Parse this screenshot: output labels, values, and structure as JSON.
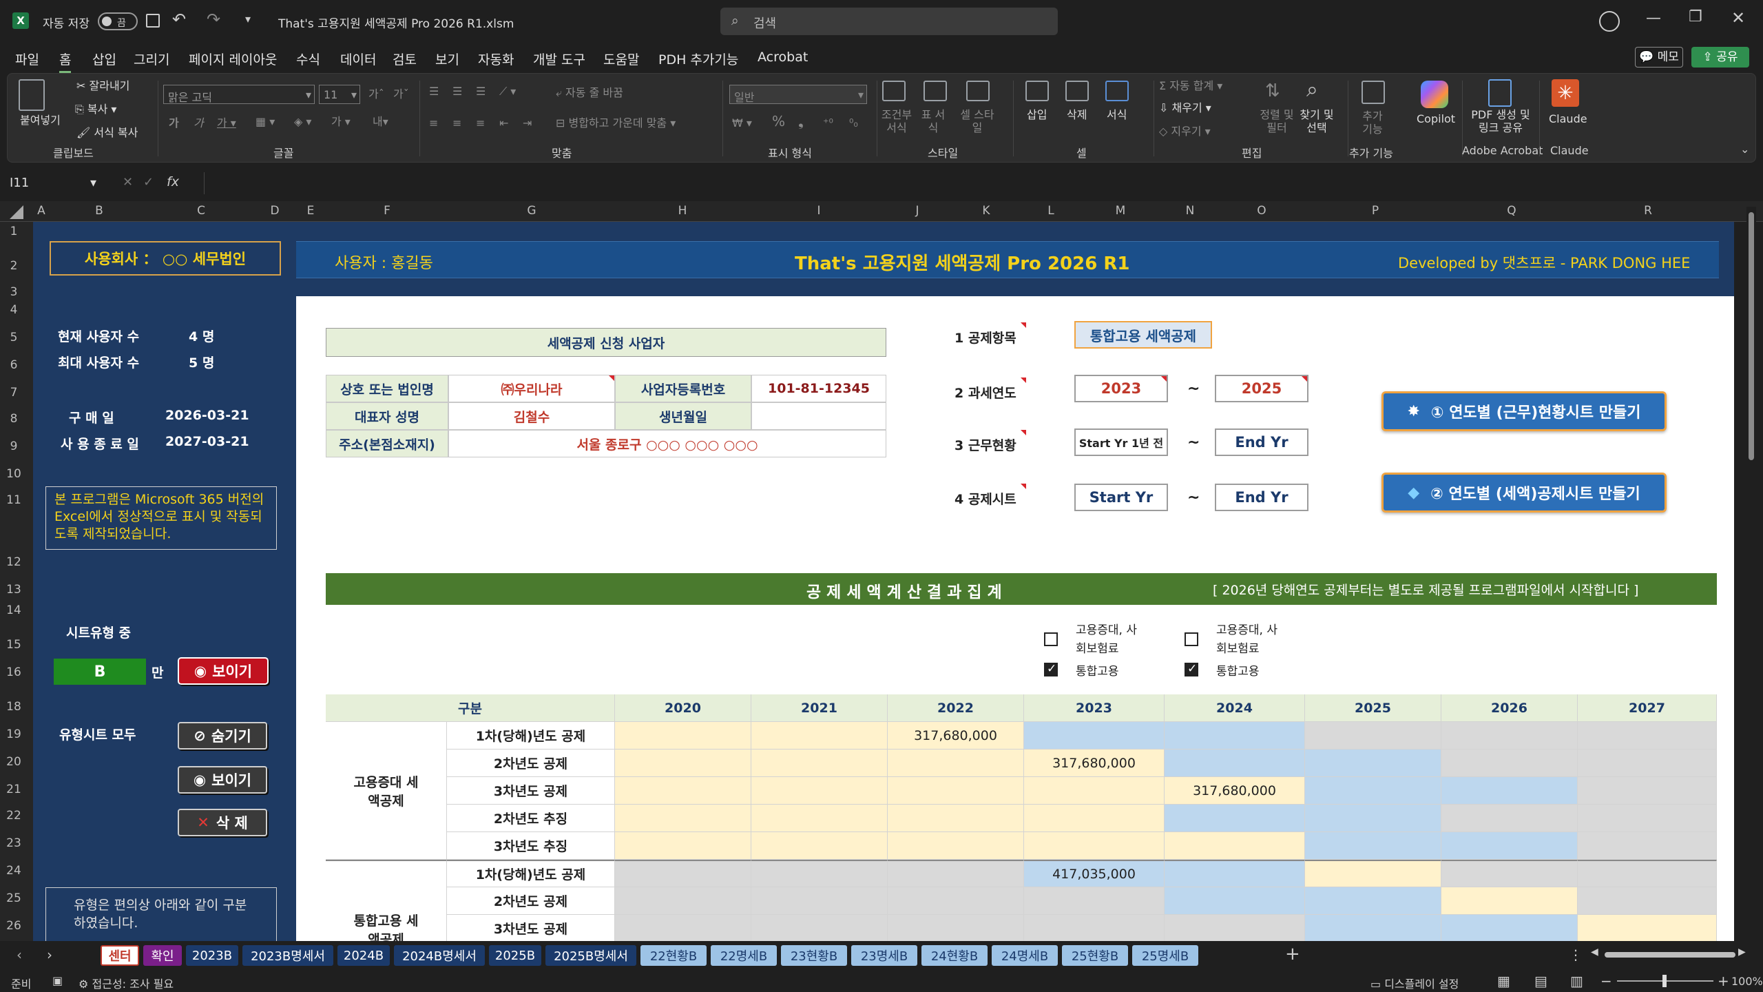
{
  "titlebar": {
    "autosave": "자동 저장",
    "autosave_state": "끔",
    "filename": "That's 고용지원 세액공제 Pro 2026 R1.xlsm",
    "search_placeholder": "검색"
  },
  "menu": [
    "파일",
    "홈",
    "삽입",
    "그리기",
    "페이지 레이아웃",
    "수식",
    "데이터",
    "검토",
    "보기",
    "자동화",
    "개발 도구",
    "도움말",
    "PDH 추가기능",
    "Acrobat"
  ],
  "menu_right": {
    "memo": "메모",
    "share": "공유"
  },
  "ribbon": {
    "clipboard": {
      "paste": "붙여넣기",
      "cut": "잘라내기",
      "copy": "복사",
      "format_painter": "서식 복사",
      "group": "클립보드"
    },
    "font": {
      "name": "맑은 고딕",
      "size": "11",
      "group": "글꼴"
    },
    "align": {
      "wrap": "자동 줄 바꿈",
      "merge": "병합하고 가운데 맞춤",
      "group": "맞춤"
    },
    "number": {
      "format": "일반",
      "group": "표시 형식"
    },
    "styles": {
      "cond": "조건부 서식",
      "table": "표 서식",
      "cell": "셀 스타일",
      "group": "스타일"
    },
    "cells": {
      "insert": "삽입",
      "delete": "삭제",
      "format": "서식",
      "group": "셀"
    },
    "editing": {
      "autosum": "자동 합계",
      "fill": "채우기",
      "clear": "지우기",
      "sort": "정렬 및 필터",
      "find": "찾기 및 선택",
      "group": "편집"
    },
    "addins": {
      "label": "추가 기능",
      "group": "추가 기능"
    },
    "copilot": "Copilot",
    "acrobat": {
      "label": "PDF 생성 및 링크 공유",
      "group": "Adobe Acrobat"
    },
    "claude": {
      "label": "Claude",
      "group": "Claude"
    }
  },
  "formula": {
    "namebox": "I11",
    "fx": "fx",
    "content": ""
  },
  "columns": [
    "A",
    "B",
    "C",
    "D",
    "E",
    "F",
    "G",
    "H",
    "I",
    "J",
    "K",
    "L",
    "M",
    "N",
    "O",
    "P",
    "Q",
    "R"
  ],
  "rows": [
    "1",
    "2",
    "3",
    "4",
    "5",
    "6",
    "7",
    "8",
    "9",
    "10",
    "11",
    "12",
    "13",
    "14",
    "15",
    "16",
    "18",
    "19",
    "20",
    "21",
    "22",
    "23",
    "24",
    "25",
    "26"
  ],
  "left": {
    "company_label": "사용회사 ： ○○ 세무법인",
    "cur_users_label": "현재 사용자 수",
    "cur_users": "4 명",
    "max_users_label": "최대 사용자 수",
    "max_users": "5 명",
    "purchase_label": "구 매 일",
    "purchase": "2026-03-21",
    "end_label": "사 용 종 료 일",
    "end": "2027-03-21",
    "notice": "본 프로그램은 Microsoft 365 버전의 Excel에서 정상적으로 표시 및 작동되도록 제작되었습니다.",
    "sheet_type_label": "시트유형 중",
    "sheet_type": "B",
    "only": "만",
    "show": "보이기",
    "all_types_label": "유형시트 모두",
    "hide_btn": "숨기기",
    "show_btn": "보이기",
    "delete_btn": "삭 제",
    "type_note": "유형은 편의상 아래와 같이 구분하였습니다."
  },
  "banner": {
    "user": "사용자 : 홍길동",
    "title": "That's 고용지원 세액공제 Pro 2026  R1",
    "dev": "Developed by 댓츠프로 - PARK DONG HEE"
  },
  "applicant": {
    "title": "세액공제 신청 사업자",
    "company_label": "상호 또는 법인명",
    "company": "㈜우리나라",
    "bizno_label": "사업자등록번호",
    "bizno": "101-81-12345",
    "ceo_label": "대표자 성명",
    "ceo": "김철수",
    "birth_label": "생년월일",
    "birth": "",
    "addr_label": "주소(본점소재지)",
    "addr": "서울 종로구 ○○○ ○○○ ○○○"
  },
  "settings": {
    "item_label": "1 공제항목",
    "item": "통합고용 세액공제",
    "year_label": "2 과세연도",
    "year_from": "2023",
    "year_to": "2025",
    "work_label": "3 근무현황",
    "work_from": "Start Yr 1년 전",
    "work_to": "End Yr",
    "sheet_label": "4 공제시트",
    "sheet_from": "Start Yr",
    "sheet_to": "End Yr",
    "tilde": "~"
  },
  "buttons": {
    "make_status": "① 연도별 (근무)현황시트 만들기",
    "make_credit": "② 연도별 (세액)공제시트 만들기"
  },
  "summary": {
    "title": "공 제 세 액   계 산 결 과   집 계",
    "note": "[ 2026년 당해연도 공제부터는 별도로 제공될 프로그램파일에서 시작합니다 ]",
    "chk1_label": "고용증대, 사회보험료",
    "chk2_label": "통합고용",
    "chk3_label": "고용증대, 사회보험료",
    "chk4_label": "통합고용",
    "header": [
      "구분",
      "2020",
      "2021",
      "2022",
      "2023",
      "2024",
      "2025",
      "2026",
      "2027"
    ],
    "group1": "고용증대 세액공제",
    "group2": "통합고용 세액공제",
    "rows": [
      {
        "label": "1차(당해)년도 공제",
        "vals": [
          "",
          "",
          "317,680,000",
          "",
          "",
          "",
          "",
          ""
        ]
      },
      {
        "label": "2차년도 공제",
        "vals": [
          "",
          "",
          "",
          "317,680,000",
          "",
          "",
          "",
          ""
        ]
      },
      {
        "label": "3차년도 공제",
        "vals": [
          "",
          "",
          "",
          "",
          "317,680,000",
          "",
          "",
          ""
        ]
      },
      {
        "label": "2차년도 추징",
        "vals": [
          "",
          "",
          "",
          "",
          "",
          "",
          "",
          ""
        ]
      },
      {
        "label": "3차년도 추징",
        "vals": [
          "",
          "",
          "",
          "",
          "",
          "",
          "",
          ""
        ]
      },
      {
        "label": "1차(당해)년도 공제",
        "vals": [
          "",
          "",
          "",
          "417,035,000",
          "",
          "",
          "",
          ""
        ]
      },
      {
        "label": "2차년도 공제",
        "vals": [
          "",
          "",
          "",
          "",
          "",
          "",
          "",
          ""
        ]
      },
      {
        "label": "3차년도 공제",
        "vals": [
          "",
          "",
          "",
          "",
          "",
          "",
          "",
          ""
        ]
      }
    ]
  },
  "tabs": [
    "센터",
    "확인",
    "2023B",
    "2023B명세서",
    "2024B",
    "2024B명세서",
    "2025B",
    "2025B명세서",
    "22현황B",
    "22명세B",
    "23현황B",
    "23명세B",
    "24현황B",
    "24명세B",
    "25현황B",
    "25명세B"
  ],
  "status": {
    "ready": "준비",
    "accessibility": "접근성: 조사 필요",
    "display": "디스플레이 설정",
    "zoom": "100%"
  }
}
